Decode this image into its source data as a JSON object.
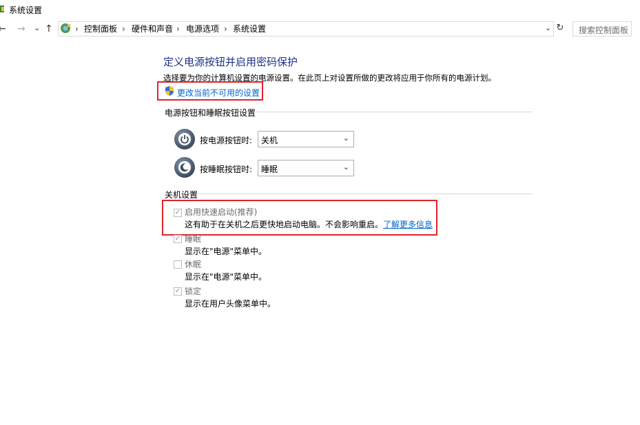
{
  "window": {
    "title": "系统设置"
  },
  "nav": {
    "back": "←",
    "forward": "→",
    "recent": "⌄",
    "up": "↑",
    "breadcrumb": [
      "控制面板",
      "硬件和声音",
      "电源选项",
      "系统设置"
    ],
    "separator": "›",
    "address_dropdown": "⌄",
    "refresh": "↻",
    "search_placeholder": "搜索控制面板"
  },
  "main": {
    "title": "定义电源按钮并启用密码保护",
    "description": "选择要为你的计算机设置的电源设置。在此页上对设置所做的更改将应用于你所有的电源计划。",
    "change_link": "更改当前不可用的设置",
    "power_section": {
      "heading": "电源按钮和睡眠按钮设置",
      "rows": [
        {
          "label": "按电源按钮时:",
          "value": "关机"
        },
        {
          "label": "按睡眠按钮时:",
          "value": "睡眠"
        }
      ]
    },
    "shutdown_section": {
      "heading": "关机设置",
      "items": [
        {
          "label": "启用快速启动(推荐)",
          "checked": true,
          "disabled": true,
          "desc": "这有助于在关机之后更快地启动电脑。不会影响重启。",
          "link": "了解更多信息"
        },
        {
          "label": "睡眠",
          "checked": true,
          "disabled": true,
          "desc": "显示在\"电源\"菜单中。"
        },
        {
          "label": "休眠",
          "checked": false,
          "disabled": true,
          "desc": "显示在\"电源\"菜单中。"
        },
        {
          "label": "锁定",
          "checked": true,
          "disabled": true,
          "desc": "显示在用户头像菜单中。"
        }
      ]
    }
  },
  "colors": {
    "title": "#1e3287",
    "link": "#0066cc",
    "highlight": "#e0222a"
  }
}
